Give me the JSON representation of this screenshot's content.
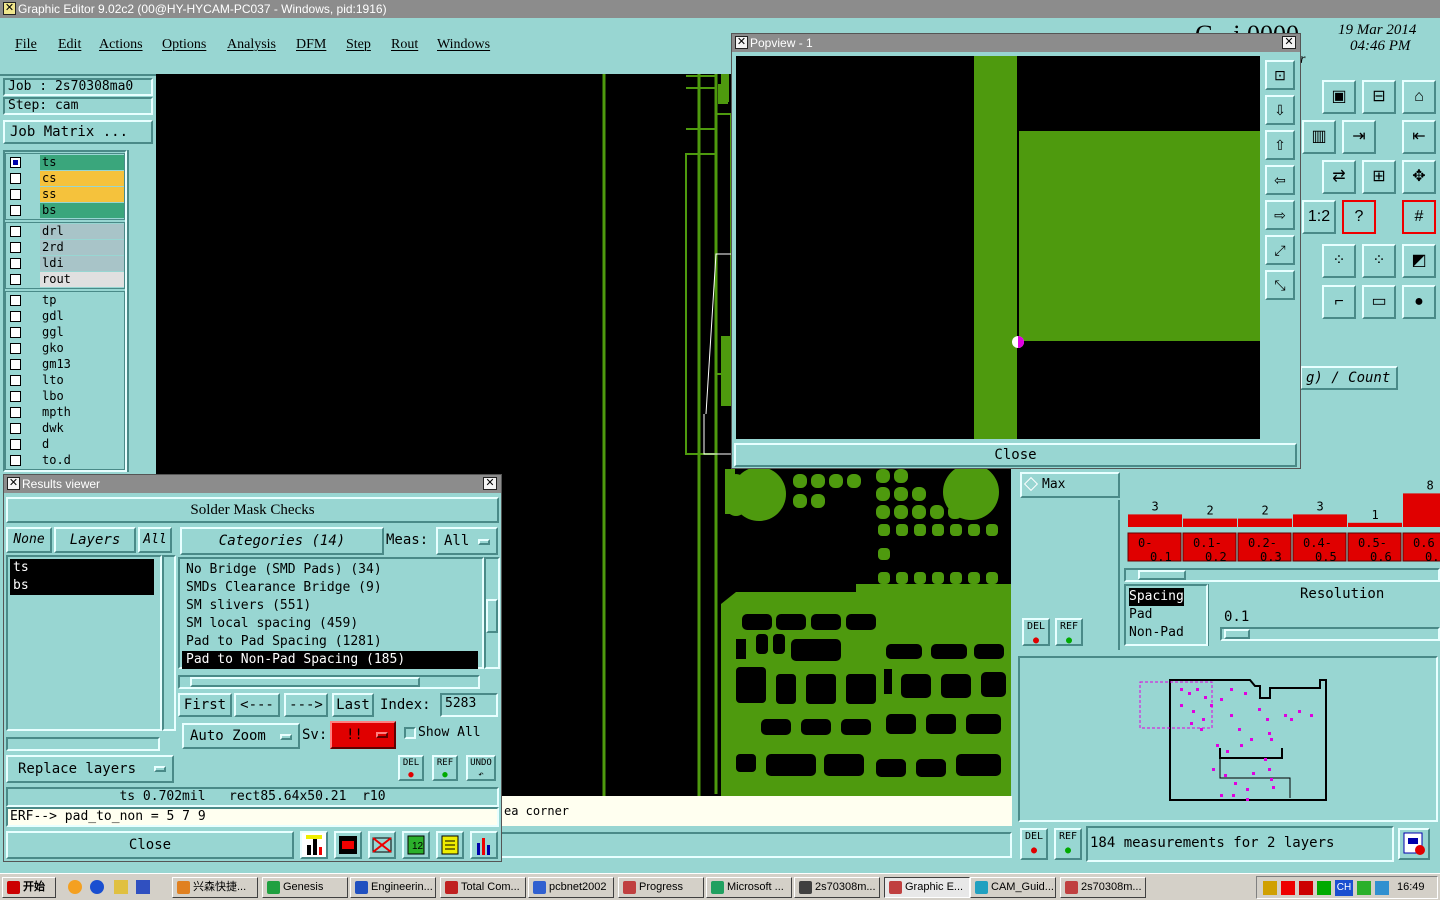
{
  "app": {
    "title": "Graphic Editor 9.02c2 (00@HY-HYCAM-PC037 - Windows, pid:1916)",
    "date": "19 Mar 2014",
    "time": "04:46 PM"
  },
  "menu": [
    "File",
    "Edit",
    "Actions",
    "Options",
    "Analysis",
    "DFM",
    "Step",
    "Rout",
    "Windows"
  ],
  "job": {
    "job_label": "Job : 2s70308ma0",
    "step_label": "Step: cam",
    "matrix_button": "Job Matrix ..."
  },
  "layers": {
    "group1": [
      {
        "name": "ts",
        "color": "#3aa67c"
      },
      {
        "name": "cs",
        "color": "#f5c23c"
      },
      {
        "name": "ss",
        "color": "#f5c23c"
      },
      {
        "name": "bs",
        "color": "#3aa67c"
      }
    ],
    "group2": [
      {
        "name": "drl",
        "color": "#a8c4c8"
      },
      {
        "name": "2rd",
        "color": "#a8c4c8"
      },
      {
        "name": "ldi",
        "color": "#a8c4c8"
      },
      {
        "name": "rout",
        "color": "#e0e0e0"
      }
    ],
    "group3": [
      {
        "name": "tp",
        "color": "#98d6d2"
      },
      {
        "name": "gdl",
        "color": "#98d6d2"
      },
      {
        "name": "ggl",
        "color": "#98d6d2"
      },
      {
        "name": "gko",
        "color": "#98d6d2"
      },
      {
        "name": "gm13",
        "color": "#98d6d2"
      },
      {
        "name": "lto",
        "color": "#98d6d2"
      },
      {
        "name": "lbo",
        "color": "#98d6d2"
      },
      {
        "name": "mpth",
        "color": "#98d6d2"
      },
      {
        "name": "dwk",
        "color": "#98d6d2"
      },
      {
        "name": "d",
        "color": "#98d6d2"
      },
      {
        "name": "to.d",
        "color": "#98d6d2"
      }
    ]
  },
  "popview": {
    "title": "Popview - 1",
    "close": "Close"
  },
  "results": {
    "title": "Results viewer",
    "header": "Solder Mask Checks",
    "none_btn": "None",
    "layers_btn": "Layers",
    "all_btn": "All",
    "layer_list": [
      "ts",
      "bs"
    ],
    "categories_btn": "Categories (14)",
    "meas_label": "Meas:",
    "meas_value": "All",
    "categories": [
      "No Bridge (SMD Pads) (34)",
      "SMDs Clearance Bridge (9)",
      "SM slivers (551)",
      "SM local spacing (459)",
      "Pad to Pad Spacing (1281)",
      "Pad to Non-Pad Spacing (185)"
    ],
    "first": "First",
    "prev": "<---",
    "next": "--->",
    "last": "Last",
    "index_label": "Index:",
    "index_value": "5283",
    "auto_zoom": "Auto Zoom",
    "sv_label": "Sv:",
    "sv_value": "!!",
    "show_all": "Show All",
    "replace_layers": "Replace layers",
    "del": "DEL",
    "ref": "REF",
    "undo": "UNDO",
    "status": "ts 0.702mil   rect85.64x50.21  r10",
    "erf": "ERF--> pad_to_non = 5 7 9",
    "close": "Close"
  },
  "canvas_hint": "ea corner",
  "histogram": {
    "max_label": "Max",
    "count_label": "g) / Count",
    "bins": [
      {
        "label": "0-",
        "label2": "0.1",
        "count": 3
      },
      {
        "label": "0.1-",
        "label2": "0.2",
        "count": 2
      },
      {
        "label": "0.2-",
        "label2": "0.3",
        "count": 2
      },
      {
        "label": "0.4-",
        "label2": "0.5",
        "count": 3
      },
      {
        "label": "0.5-",
        "label2": "0.6",
        "count": 1
      },
      {
        "label": "0.6",
        "label2": "0.",
        "count": 8
      }
    ],
    "spacing_list": [
      "Spacing",
      "Pad",
      "Non-Pad"
    ],
    "resolution_label": "Resolution",
    "resolution_value": "0.1",
    "del": "DEL",
    "ref": "REF"
  },
  "measurements": {
    "text": "184 measurements for 2 layers",
    "del": "DEL",
    "ref": "REF"
  },
  "topright": {
    "partial": "G...i 0000",
    "partial2": "r"
  },
  "taskbar": {
    "start": "开始",
    "tasks": [
      "兴森快捷...",
      "Genesis",
      "Engineerin...",
      "Total Com...",
      "pcbnet2002",
      "Progress",
      "Microsoft ...",
      "2s70308m...",
      "Graphic E...",
      "CAM_Guid...",
      "2s70308m..."
    ],
    "clock": "16:49",
    "tray": "CH"
  },
  "colors": {
    "green": "#4e9a0e",
    "teal": "#98d6d2",
    "red": "#e00000",
    "magenta": "#e000e0"
  }
}
